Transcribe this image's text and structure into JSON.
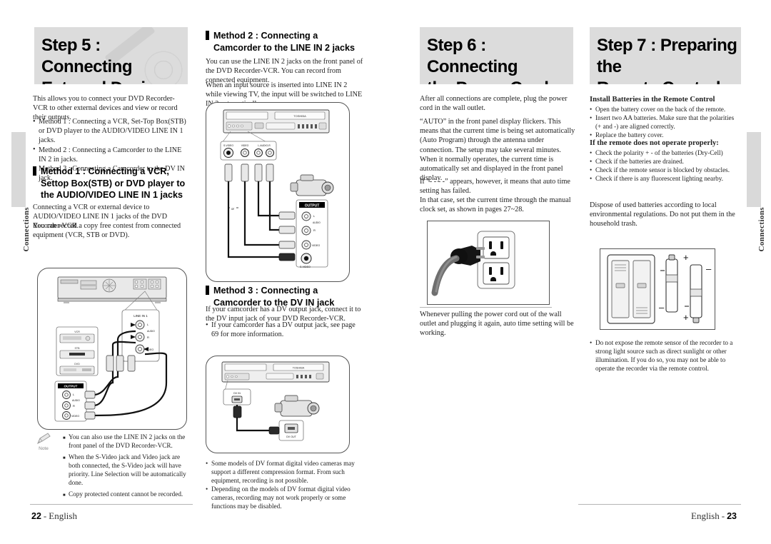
{
  "document": {
    "type": "printed-manual-spread",
    "left_page_folio": {
      "number": "22",
      "sep": "-",
      "lang": "English"
    },
    "right_page_folio": {
      "lang": "English",
      "sep": "-",
      "number": "23"
    },
    "side_tab_left": "Connections",
    "side_tab_right": "Connections"
  },
  "left_page": {
    "step5": {
      "title_line1": "Step 5 : Connecting",
      "title_line2": "External Devices",
      "intro": "This allows you to connect your DVD Recorder-VCR to other external devices and view or record their outputs.",
      "methods": [
        "Method 1 : Connecting a VCR, Set-Top Box(STB) or DVD player to the AUDIO/VIDEO LINE IN 1 jacks.",
        "Method 2 : Connecting a Camcorder to the LINE IN 2 in jacks.",
        "Method 3 : Connecting a Camcorder to the DV IN jack."
      ],
      "method_labels": [
        "Method 1 :",
        "Method 2 :",
        "Method 3 :"
      ],
      "method_rests": [
        "Connecting a VCR, Set-Top Box(STB) or DVD player to the AUDIO/VIDEO LINE IN 1 jacks.",
        "Connecting a Camcorder to the LINE IN 2 in jacks.",
        "Connecting a Camcorder to the DV IN jack."
      ]
    },
    "method1": {
      "heading_line1": "Method 1 : Connecting a VCR,",
      "heading_line2": "Settop Box(STB) or DVD player to",
      "heading_line3": "the AUDIO/VIDEO LINE IN 1 jacks",
      "para1": "Connecting a VCR or external device to AUDIO/VIDEO LINE IN 1 jacks of the DVD Recorder-VCR.",
      "para2": "You can record a copy free contest from connected equipment (VCR, STB or DVD)."
    },
    "note": {
      "icon_label": "Note",
      "items": [
        "You can also use the LINE IN 2 jacks on the front panel of the DVD Recorder-VCR.",
        "When the S-Video jack and Video jack are both connected, the S-Video jack will have priority. Line Selection will be automatically done.",
        "Copy protected content cannot be recorded."
      ]
    },
    "figure_method1": {
      "caption_output": "OUTPUT",
      "caption_line_in1": "LINE IN 1",
      "jack_labels": [
        "L",
        "AUDIO",
        "R",
        "VIDEO"
      ],
      "device_labels": [
        "VCR",
        "STB",
        "DVD"
      ]
    },
    "method2": {
      "heading_line1": "Method 2 : Connecting a",
      "heading_line2": "Camcorder to the LINE IN 2 jacks",
      "para1": "You can use the LINE IN 2 jacks on the front panel of the DVD Recorder-VCR. You can record from connected equipment.",
      "para2": "When an input source is inserted into LINE IN 2 while viewing TV, the input will be switched to LINE IN 2 automatically."
    },
    "figure_method2": {
      "front_jacks": [
        "S-VIDEO",
        "VIDEO",
        "L-AUDIO-R"
      ],
      "brand": "TOSHIBA",
      "or_label": "or",
      "output_label": "OUTPUT",
      "output_jacks": [
        "L",
        "AUDIO",
        "R",
        "VIDEO",
        "S-VIDEO"
      ]
    },
    "method3": {
      "heading_line1": "Method 3 : Connecting a",
      "heading_line2": "Camcorder to the DV IN jack",
      "para1": "If your camcorder has a DV output jack, connect it to the DV input jack of your DVD Recorder-VCR.",
      "bullets": [
        "If your camcorder has a DV output jack, see page 69 for more information."
      ]
    },
    "figure_method3": {
      "dv_in_label": "DV IN",
      "dv_out_label": "DV OUT",
      "brand": "TOSHIBA"
    },
    "method3_notes": [
      "Some models of DV format digital video cameras may support a different compression format. From such equipment, recording is not possible.",
      "Depending on the models of DV format digital video cameras, recording may not work properly or some functions may be disabled."
    ]
  },
  "right_page": {
    "step6": {
      "title_line1": "Step 6 : Connecting",
      "title_line2": "the Power Cord",
      "para1": "After all connections are complete, plug the power cord in the wall outlet.",
      "para2": "“AUTO” in the front panel display flickers. This means that the current time is being set automatically (Auto Program) through the antenna under connection. The setup may take several minutes.",
      "para3": "When it normally operates, the current time is automatically set and displayed in the front panel display.",
      "para4": "If “- - - -” appears, however, it means that auto time setting has failed.",
      "para5": "In that case, set the current time through the manual clock set, as shown in pages 27~28.",
      "para6": "Whenever pulling the power cord out of the wall outlet and plugging it again, auto time setting will be working."
    },
    "step7": {
      "title_line1": "Step 7 : Preparing the",
      "title_line2": "Remote Control",
      "install_heading": "Install Batteries in the Remote Control",
      "install_bullets": [
        "Open the battery cover on the back of the remote.",
        "Insert two AA batteries. Make sure that the polarities (+ and -) are aligned correctly.",
        "Replace the battery cover."
      ],
      "trouble_heading": "If the remote does not operate properly:",
      "trouble_bullets": [
        "Check the polarity + - of the batteries (Dry-Cell)",
        "Check if the batteries are drained.",
        "Check if the remote sensor is blocked by obstacles.",
        "Check if there is any fluorescent lighting nearby."
      ],
      "dispose_note": "Dispose of used batteries according to local environmental regulations. Do not put them in the household trash.",
      "caution_bullet": "Do not expose the remote sensor of the  recorder to a strong light source such as direct sunlight or other illumination. If you do so, you may not be able to operate the recorder via the remote control."
    },
    "figure_battery": {
      "plus": "+",
      "minus": "–"
    }
  },
  "colors": {
    "heading_bg": "#dcdcdc",
    "tab_bg": "#d9d9d9",
    "text": "#222222",
    "rule": "#b5b5b5"
  }
}
